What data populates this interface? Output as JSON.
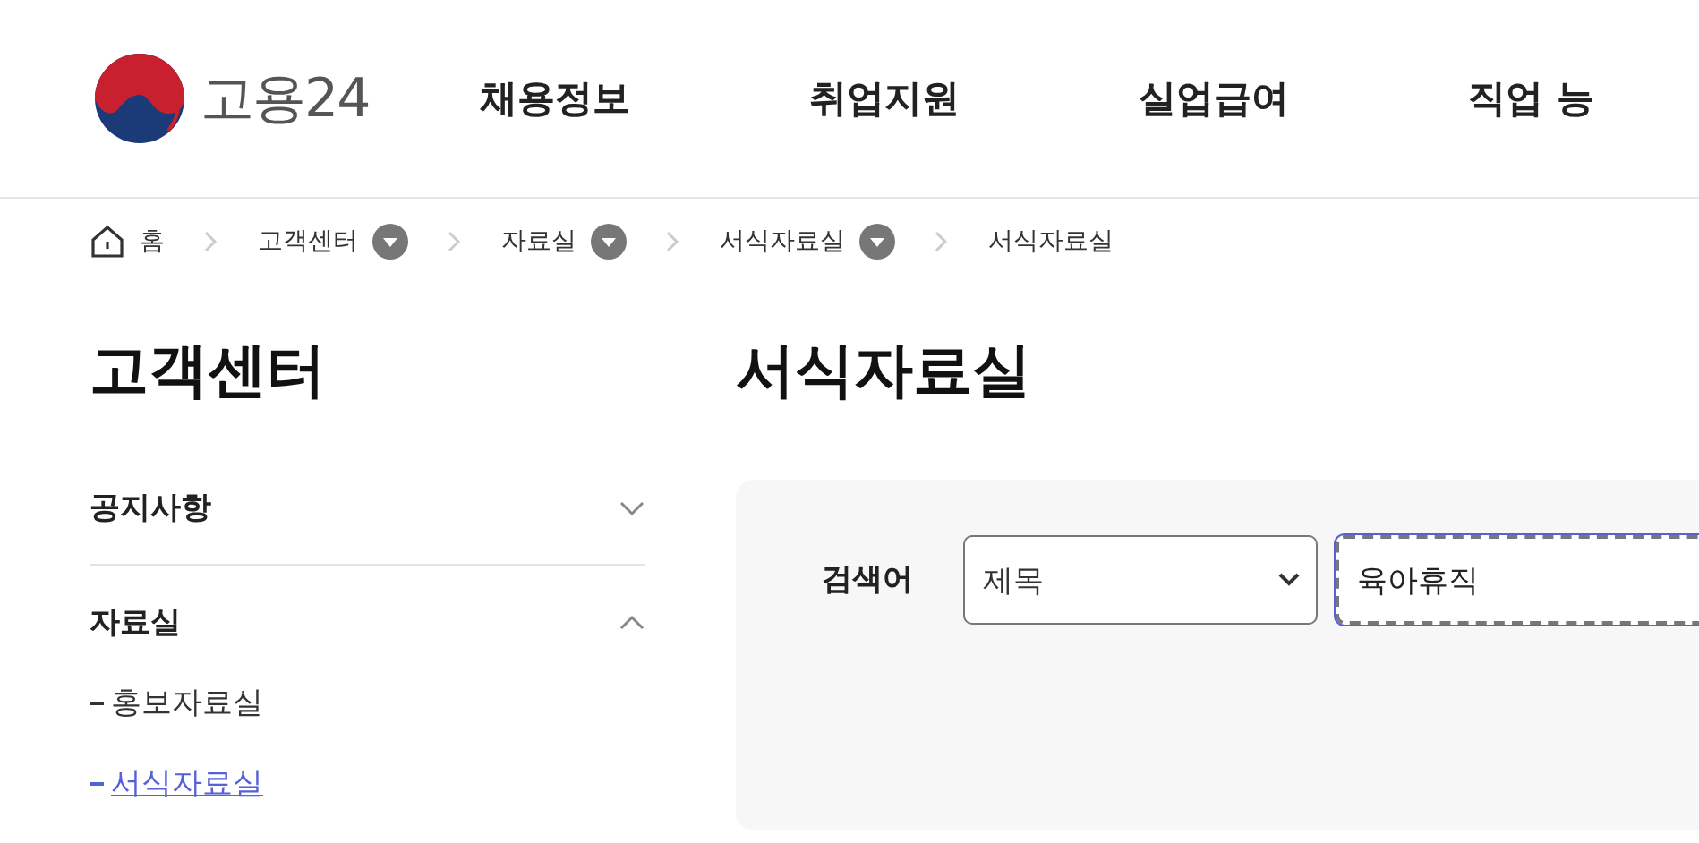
{
  "header": {
    "logo_text": "고용24",
    "nav": [
      {
        "label": "채용정보"
      },
      {
        "label": "취업지원"
      },
      {
        "label": "실업급여"
      },
      {
        "label": "직업 능"
      }
    ]
  },
  "breadcrumb": [
    {
      "kind": "home",
      "label": "홈"
    },
    {
      "kind": "menu",
      "label": "고객센터"
    },
    {
      "kind": "menu",
      "label": "자료실"
    },
    {
      "kind": "menu",
      "label": "서식자료실"
    },
    {
      "kind": "current",
      "label": "서식자료실"
    }
  ],
  "sidebar": {
    "title": "고객센터",
    "items": [
      {
        "label": "공지사항",
        "expanded": false
      },
      {
        "label": "자료실",
        "expanded": true,
        "children": [
          {
            "label": "홍보자료실",
            "selected": false
          },
          {
            "label": "서식자료실",
            "selected": true
          }
        ]
      }
    ]
  },
  "main": {
    "title": "서식자료실",
    "search": {
      "label": "검색어",
      "select_value": "제목",
      "query": "육아휴직"
    }
  }
}
